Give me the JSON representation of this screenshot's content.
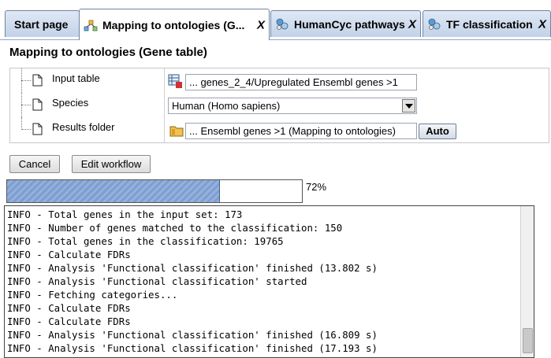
{
  "tabs": [
    {
      "label": "Start page",
      "icon": "",
      "closable": false,
      "active": false
    },
    {
      "label": "Mapping to ontologies (G...",
      "icon": "workflow-icon",
      "closable": true,
      "active": true
    },
    {
      "label": "HumanCyc pathways",
      "icon": "pathway-icon",
      "closable": true,
      "active": false
    },
    {
      "label": "TF classification",
      "icon": "pathway-icon",
      "closable": true,
      "active": false
    }
  ],
  "tab_close_label": "X",
  "title": "Mapping to ontologies (Gene table)",
  "properties": {
    "input_table": {
      "label": "Input table",
      "value": "... genes_2_4/Upregulated Ensembl genes >1",
      "icon": "table-icon"
    },
    "species": {
      "label": "Species",
      "value": "Human (Homo sapiens)"
    },
    "results_folder": {
      "label": "Results folder",
      "value": "... Ensembl genes >1 (Mapping to ontologies)",
      "icon": "folder-icon",
      "auto_label": "Auto"
    }
  },
  "buttons": {
    "cancel": "Cancel",
    "edit_workflow": "Edit workflow"
  },
  "progress": {
    "percent": 72,
    "label": "72%"
  },
  "log_lines": [
    "INFO - Total genes in the input set: 173",
    "INFO - Number of genes matched to the classification: 150",
    "INFO - Total genes in the classification: 19765",
    "INFO - Calculate FDRs",
    "INFO - Analysis 'Functional classification' finished (13.802 s)",
    "INFO - Analysis 'Functional classification' started",
    "INFO - Fetching categories...",
    "INFO - Calculate FDRs",
    "INFO - Calculate FDRs",
    "INFO - Analysis 'Functional classification' finished (16.809 s)",
    "INFO - Analysis 'Functional classification' finished (17.193 s)"
  ],
  "colors": {
    "tab_bg": "#c3d2e8",
    "progress_fill": "#7e9ed0",
    "border": "#6d84a6"
  }
}
